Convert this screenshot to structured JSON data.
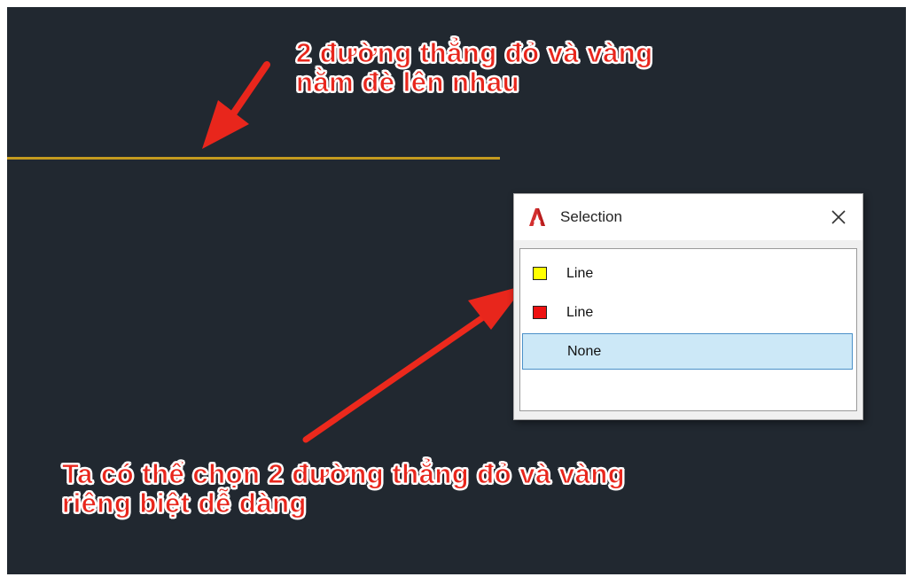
{
  "annotations": {
    "top_line1": "2 đường thẳng đỏ và vàng",
    "top_line2": "nằm đè lên nhau",
    "bottom_line1": "Ta có thể chọn 2 đường thẳng đỏ và vàng",
    "bottom_line2": "riêng biệt dễ dàng"
  },
  "dialog": {
    "title": "Selection",
    "close_icon": "close-icon",
    "app_icon": "autocad-a-icon",
    "items": [
      {
        "label": "Line",
        "color": "#ffff00"
      },
      {
        "label": "Line",
        "color": "#ee1111"
      },
      {
        "label": "None",
        "selected": true
      }
    ]
  },
  "colors": {
    "canvas": "#212830",
    "overlapping_line": "#c49a1f",
    "annotation_text": "#e8261c",
    "arrow": "#e8261c",
    "selection_highlight": "#cce8f7"
  }
}
